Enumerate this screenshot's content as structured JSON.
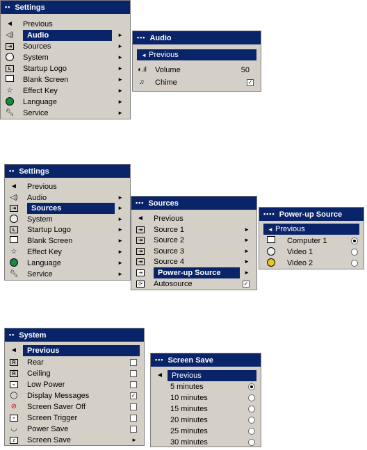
{
  "settings_audio": {
    "title": "Settings",
    "items": [
      {
        "label": "Previous",
        "icon": "previous-arrow-icon"
      },
      {
        "label": "Audio",
        "icon": "speaker-icon"
      },
      {
        "label": "Sources",
        "icon": "source-icon"
      },
      {
        "label": "System",
        "icon": "system-icon"
      },
      {
        "label": "Startup Logo",
        "icon": "logo-icon"
      },
      {
        "label": "Blank Screen",
        "icon": "blank-screen-icon"
      },
      {
        "label": "Effect Key",
        "icon": "star-icon"
      },
      {
        "label": "Language",
        "icon": "globe-icon"
      },
      {
        "label": "Service",
        "icon": "wrench-icon"
      }
    ],
    "selected": "Audio"
  },
  "audio": {
    "title": "Audio",
    "previous": "Previous",
    "volume_label": "Volume",
    "volume_value": "50",
    "chime_label": "Chime",
    "chime_checked": true
  },
  "settings_sources": {
    "title": "Settings",
    "items": [
      {
        "label": "Previous"
      },
      {
        "label": "Audio"
      },
      {
        "label": "Sources"
      },
      {
        "label": "System"
      },
      {
        "label": "Startup Logo"
      },
      {
        "label": "Blank Screen"
      },
      {
        "label": "Effect Key"
      },
      {
        "label": "Language"
      },
      {
        "label": "Service"
      }
    ],
    "selected": "Sources"
  },
  "sources": {
    "title": "Sources",
    "items": [
      {
        "label": "Previous"
      },
      {
        "label": "Source 1"
      },
      {
        "label": "Source 2"
      },
      {
        "label": "Source 3"
      },
      {
        "label": "Source 4"
      },
      {
        "label": "Power-up Source"
      },
      {
        "label": "Autosource"
      }
    ],
    "selected": "Power-up Source",
    "autosource_checked": true
  },
  "powerup": {
    "title": "Power-up Source",
    "previous": "Previous",
    "items": [
      {
        "label": "Computer 1",
        "selected": true
      },
      {
        "label": "Video 1",
        "selected": false
      },
      {
        "label": "Video 2",
        "selected": false
      }
    ]
  },
  "system": {
    "title": "System",
    "previous": "Previous",
    "items": [
      {
        "label": "Rear",
        "checked": false
      },
      {
        "label": "Ceiling",
        "checked": false
      },
      {
        "label": "Low Power",
        "checked": false
      },
      {
        "label": "Display Messages",
        "checked": true
      },
      {
        "label": "Screen Saver Off",
        "checked": false
      },
      {
        "label": "Screen Trigger",
        "checked": false
      },
      {
        "label": "Power Save",
        "checked": false
      },
      {
        "label": "Screen Save",
        "submenu": true
      }
    ]
  },
  "screensave": {
    "title": "Screen Save",
    "previous": "Previous",
    "items": [
      {
        "label": "5 minutes",
        "selected": true
      },
      {
        "label": "10 minutes",
        "selected": false
      },
      {
        "label": "15 minutes",
        "selected": false
      },
      {
        "label": "20 minutes",
        "selected": false
      },
      {
        "label": "25 minutes",
        "selected": false
      },
      {
        "label": "30 minutes",
        "selected": false
      }
    ]
  },
  "glyphs": {
    "dots2": "••",
    "dots3": "•••",
    "dots4": "••••",
    "left": "◄",
    "right": "►",
    "check": "✓"
  }
}
